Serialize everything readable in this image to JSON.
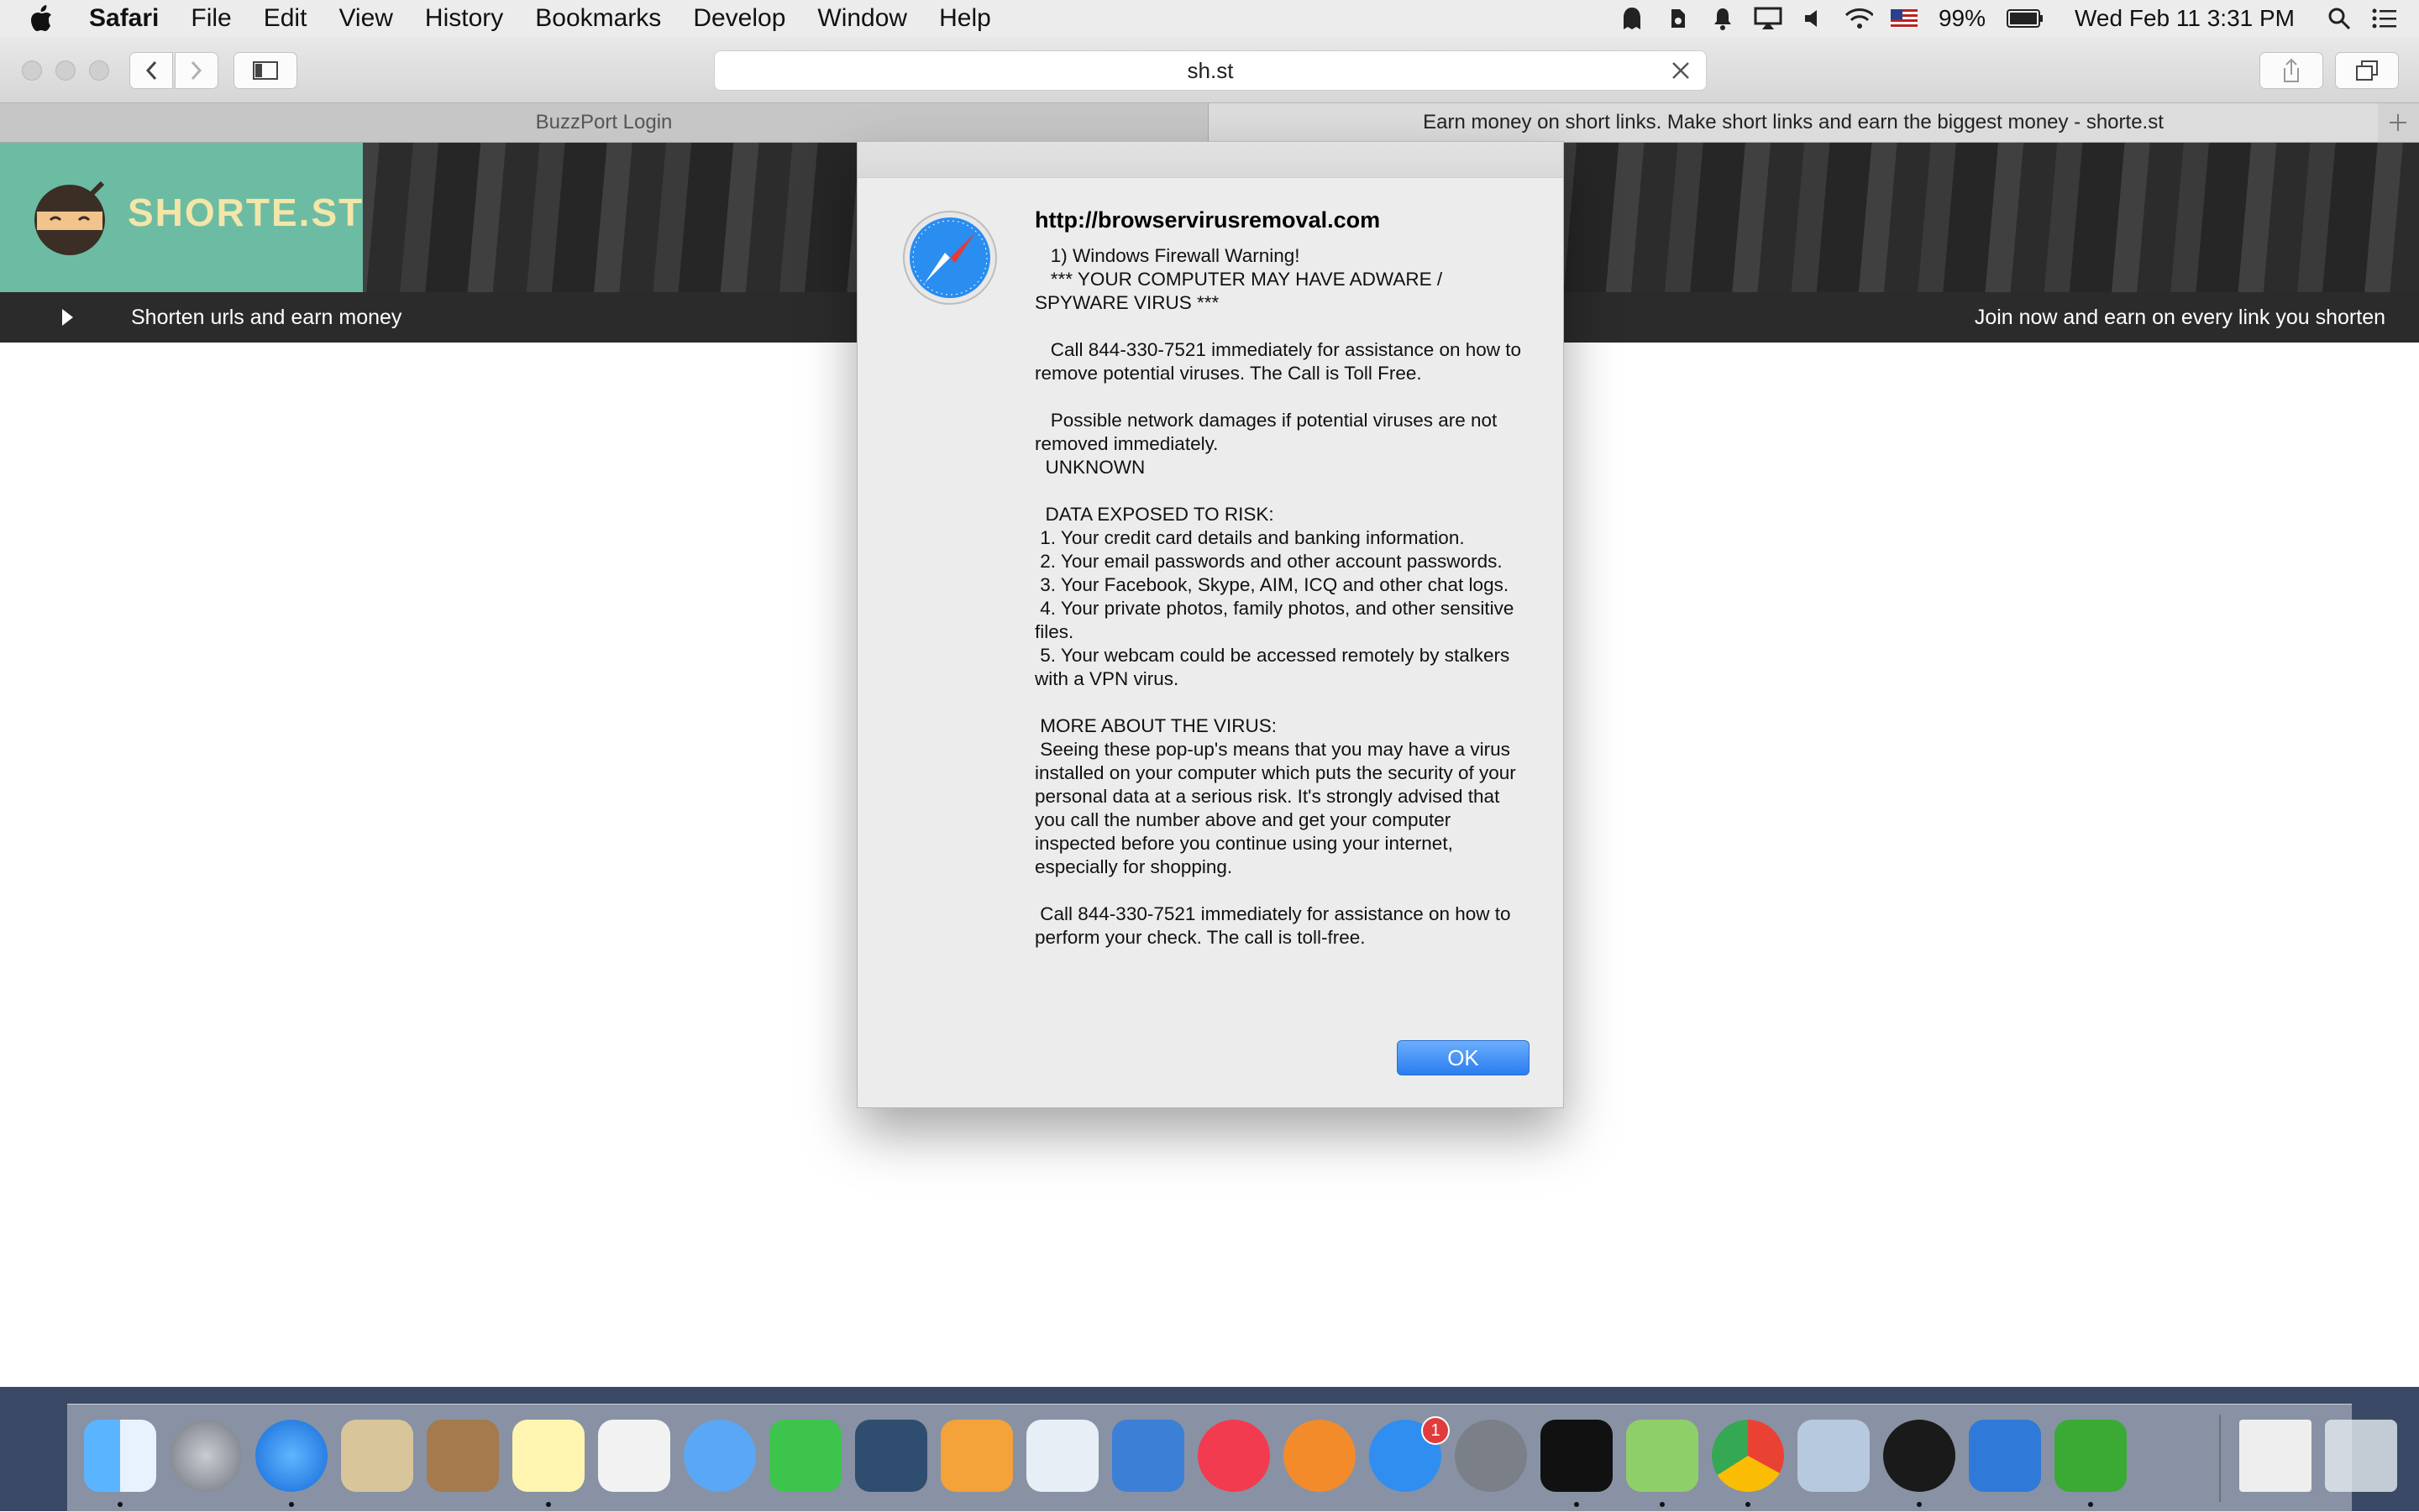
{
  "menubar": {
    "app": "Safari",
    "items": [
      "File",
      "Edit",
      "View",
      "History",
      "Bookmarks",
      "Develop",
      "Window",
      "Help"
    ],
    "battery": "99%",
    "datetime": "Wed Feb 11  3:31 PM"
  },
  "toolbar": {
    "url": "sh.st"
  },
  "tabs": [
    {
      "label": "BuzzPort Login"
    },
    {
      "label": "Earn money on short links. Make short links and earn the biggest money - shorte.st"
    }
  ],
  "site": {
    "brand": "SHORTE.ST",
    "subnav_left": "Shorten urls and earn money",
    "subnav_right": "Join now and earn on every link you shorten"
  },
  "dialog": {
    "title": "http://browservirusremoval.com",
    "body": "   1) Windows Firewall Warning!\n   *** YOUR COMPUTER MAY HAVE ADWARE / SPYWARE VIRUS ***\n\n   Call 844-330-7521 immediately for assistance on how to remove potential viruses. The Call is Toll Free.\n\n   Possible network damages if potential viruses are not removed immediately.\n  UNKNOWN\n\n  DATA EXPOSED TO RISK:\n 1. Your credit card details and banking information.\n 2. Your email passwords and other account passwords.\n 3. Your Facebook, Skype, AIM, ICQ and other chat logs.\n 4. Your private photos, family photos, and other sensitive files.\n 5. Your webcam could be accessed remotely by stalkers with a VPN virus.\n\n MORE ABOUT THE VIRUS:\n Seeing these pop-up's means that you may have a virus installed on your computer which puts the security of your personal data at a serious risk. It's strongly advised that you call the number above and get your computer inspected before you continue using your internet, especially for shopping.\n\n Call 844-330-7521 immediately for assistance on how to perform your check. The call is toll-free.",
    "ok_label": "OK"
  },
  "dock": {
    "app_store_badge": "1",
    "items": [
      "finder-icon",
      "launchpad-icon",
      "safari-icon",
      "mail-icon",
      "contacts-icon",
      "notes-icon",
      "calendar-icon",
      "messages-icon",
      "facetime-icon",
      "photo-booth-icon",
      "pages-icon",
      "numbers-icon",
      "keynote-icon",
      "itunes-icon",
      "ibooks-icon",
      "app-store-icon",
      "system-preferences-icon",
      "terminal-icon",
      "cyberduck-icon",
      "chrome-icon",
      "preview-icon",
      "qq-icon",
      "word-icon",
      "evernote-icon",
      "document-icon",
      "trash-icon"
    ]
  }
}
